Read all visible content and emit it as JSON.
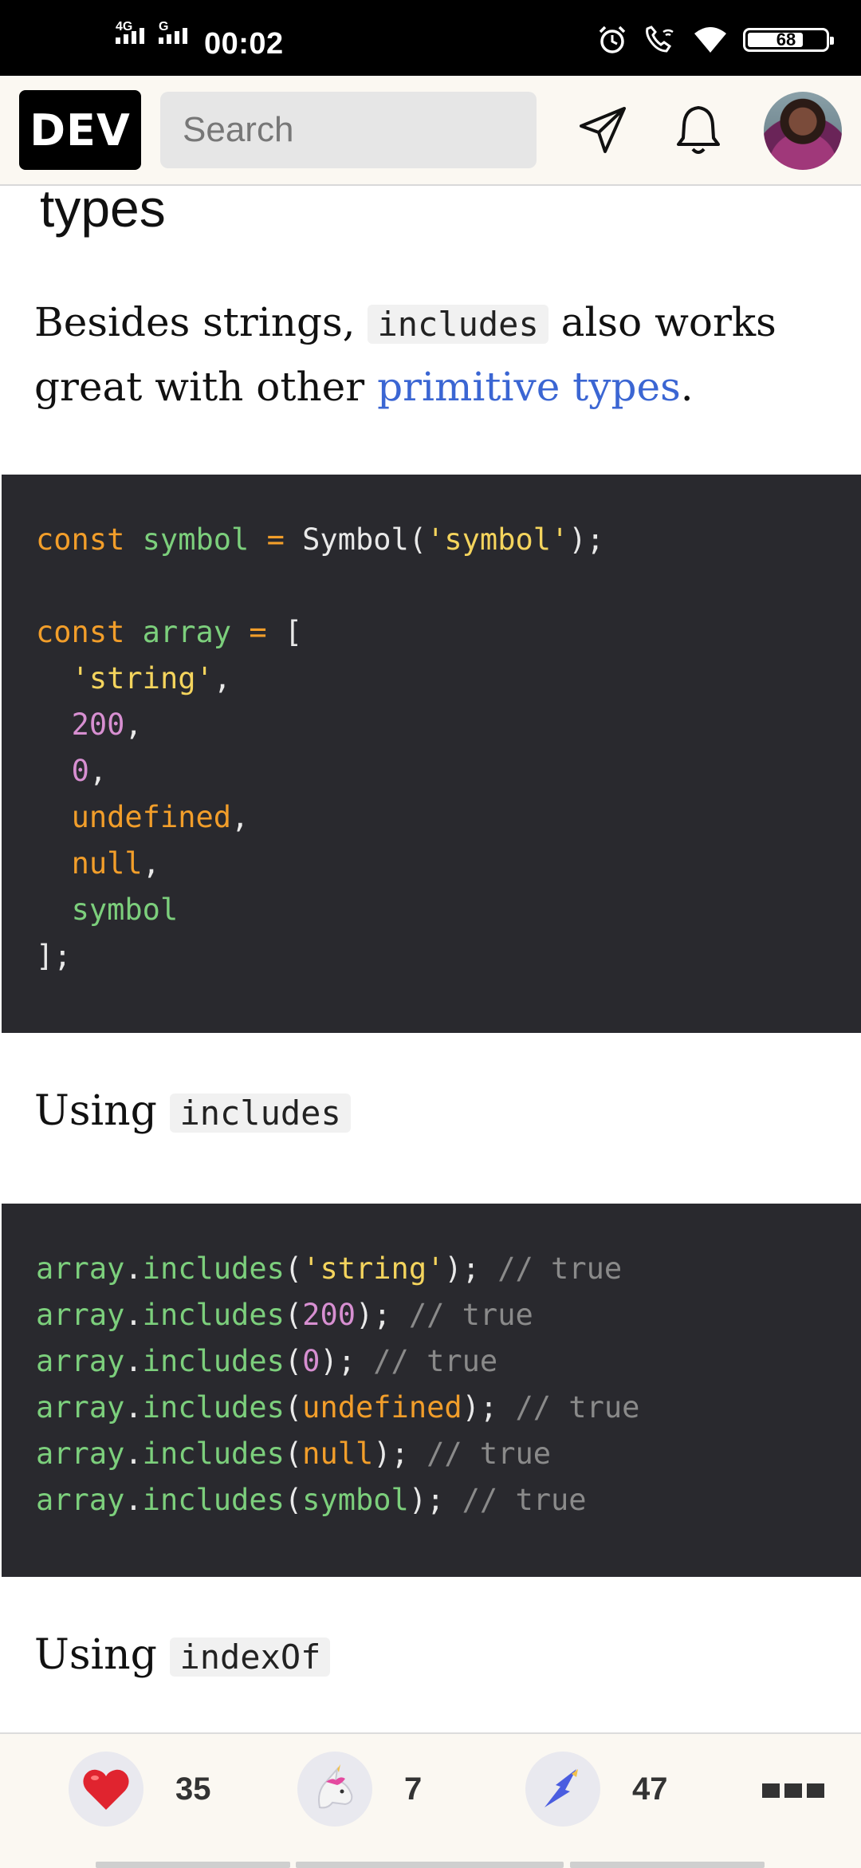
{
  "status_bar": {
    "net1": "4G",
    "net2": "G",
    "time": "00:02",
    "battery": "68"
  },
  "topbar": {
    "logo": "DEV",
    "search_placeholder": "Search"
  },
  "article": {
    "heading_fragment": "types",
    "para_before": "Besides strings, ",
    "para_code": "includes",
    "para_middle": " also works great with other ",
    "para_link": "primitive types",
    "para_end": ".",
    "code1": [
      [
        [
          "k",
          "const "
        ],
        [
          "v",
          "symbol "
        ],
        [
          "k",
          "= "
        ],
        [
          "p",
          "Symbol("
        ],
        [
          "s",
          "'symbol'"
        ],
        [
          "p",
          ");"
        ]
      ],
      [],
      [
        [
          "k",
          "const "
        ],
        [
          "v",
          "array "
        ],
        [
          "k",
          "= "
        ],
        [
          "p",
          "["
        ]
      ],
      [
        [
          "p",
          "  "
        ],
        [
          "s",
          "'string'"
        ],
        [
          "p",
          ","
        ]
      ],
      [
        [
          "p",
          "  "
        ],
        [
          "n",
          "200"
        ],
        [
          "p",
          ","
        ]
      ],
      [
        [
          "p",
          "  "
        ],
        [
          "n",
          "0"
        ],
        [
          "p",
          ","
        ]
      ],
      [
        [
          "p",
          "  "
        ],
        [
          "k",
          "undefined"
        ],
        [
          "p",
          ","
        ]
      ],
      [
        [
          "p",
          "  "
        ],
        [
          "k",
          "null"
        ],
        [
          "p",
          ","
        ]
      ],
      [
        [
          "p",
          "  "
        ],
        [
          "v",
          "symbol"
        ]
      ],
      [
        [
          "p",
          "];"
        ]
      ]
    ],
    "using1_prefix": "Using ",
    "using1_code": "includes",
    "code2": [
      [
        [
          "v",
          "array"
        ],
        [
          "p",
          "."
        ],
        [
          "v",
          "includes"
        ],
        [
          "p",
          "("
        ],
        [
          "s",
          "'string'"
        ],
        [
          "p",
          "); "
        ],
        [
          "c",
          "// true"
        ]
      ],
      [
        [
          "v",
          "array"
        ],
        [
          "p",
          "."
        ],
        [
          "v",
          "includes"
        ],
        [
          "p",
          "("
        ],
        [
          "n",
          "200"
        ],
        [
          "p",
          "); "
        ],
        [
          "c",
          "// true"
        ]
      ],
      [
        [
          "v",
          "array"
        ],
        [
          "p",
          "."
        ],
        [
          "v",
          "includes"
        ],
        [
          "p",
          "("
        ],
        [
          "n",
          "0"
        ],
        [
          "p",
          "); "
        ],
        [
          "c",
          "// true"
        ]
      ],
      [
        [
          "v",
          "array"
        ],
        [
          "p",
          "."
        ],
        [
          "v",
          "includes"
        ],
        [
          "p",
          "("
        ],
        [
          "k",
          "undefined"
        ],
        [
          "p",
          "); "
        ],
        [
          "c",
          "// true"
        ]
      ],
      [
        [
          "v",
          "array"
        ],
        [
          "p",
          "."
        ],
        [
          "v",
          "includes"
        ],
        [
          "p",
          "("
        ],
        [
          "k",
          "null"
        ],
        [
          "p",
          "); "
        ],
        [
          "c",
          "// true"
        ]
      ],
      [
        [
          "v",
          "array"
        ],
        [
          "p",
          "."
        ],
        [
          "v",
          "includes"
        ],
        [
          "p",
          "("
        ],
        [
          "v",
          "symbol"
        ],
        [
          "p",
          "); "
        ],
        [
          "c",
          "// true"
        ]
      ]
    ],
    "using2_prefix": "Using ",
    "using2_code": "indexOf"
  },
  "reactions": {
    "hearts": "35",
    "unicorns": "7",
    "bookmarks": "47"
  },
  "colors": {
    "link": "#3b66d3",
    "code_bg": "#29292e",
    "keyword": "#f29e2a",
    "variable": "#7ccf7c",
    "string": "#f4d45d",
    "number": "#d78fd1",
    "comment": "#8a8a8a"
  }
}
